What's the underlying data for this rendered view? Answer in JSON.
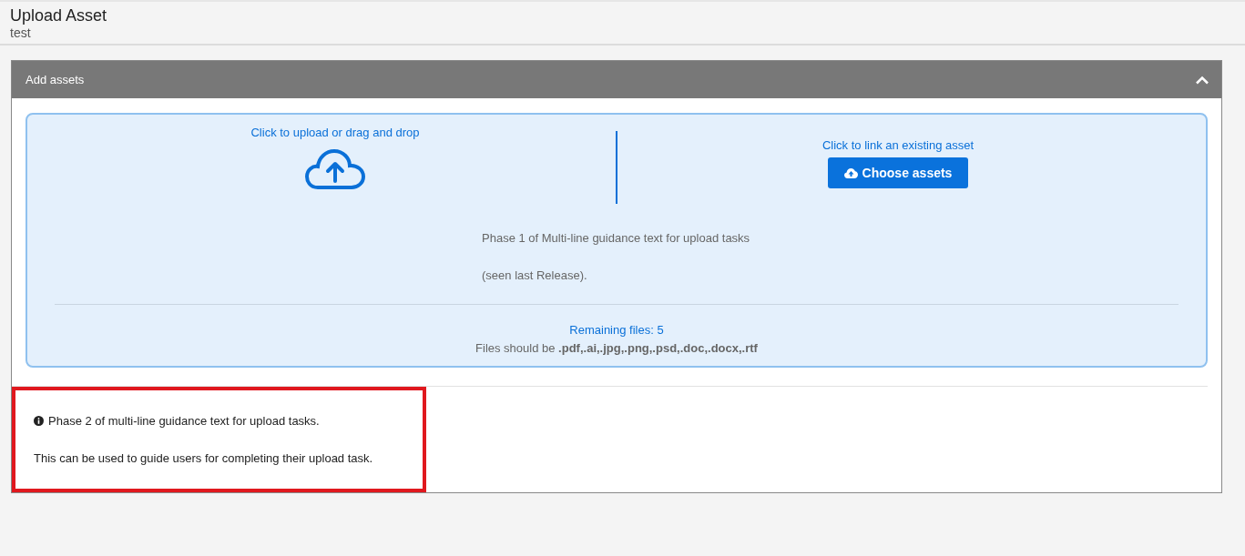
{
  "page": {
    "title": "Upload Asset",
    "subtitle": "test"
  },
  "panel": {
    "title": "Add assets",
    "expanded": true,
    "upload": {
      "label": "Click to upload or drag and drop"
    },
    "link": {
      "label": "Click to link an existing asset",
      "button": "Choose assets"
    },
    "guidance": [
      "Phase 1 of Multi-line guidance text for upload tasks",
      "(seen last Release)."
    ],
    "remaining": "Remaining files: 5",
    "file_types": "Files should be **.pdf,.ai,.jpg,.png,.psd,.doc,.docx,.rtf**",
    "phase2": [
      "Phase 2 of multi-line guidance text for upload tasks.",
      "This can be used to guide users for completing their upload task."
    ],
    "highlighted": true
  }
}
